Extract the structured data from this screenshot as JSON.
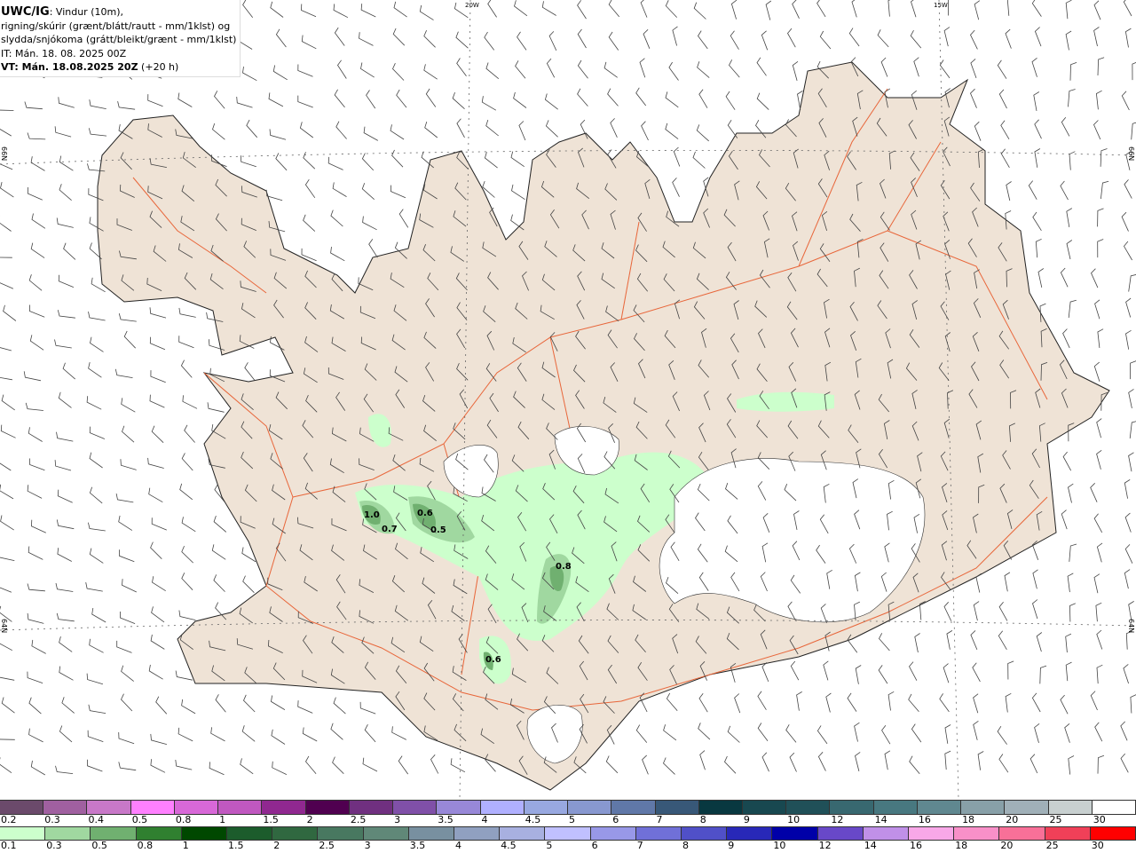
{
  "header": {
    "product": "UWC/IG",
    "line1": ": Vindur (10m),",
    "line2": "rigning/skúrir (grænt/blátt/rautt - mm/1klst) og",
    "line3": "slydda/snjókoma (grátt/bleikt/grænt - mm/1klst)",
    "it": "IT: Mán. 18. 08. 2025 00Z",
    "vt_bold": "VT: Mán. 18.08.2025 20Z",
    "vt_lead": " (+20 h)"
  },
  "map": {
    "grid_labels": {
      "lon_20w": "20W",
      "lon_15w": "15W",
      "lat_66n": "66N",
      "lat_64n": "64N"
    },
    "precip_labels": [
      "1.0",
      "0.7",
      "0.6",
      "0.5",
      "0.8",
      "0.6"
    ],
    "colors": {
      "land": "#efe3d6",
      "sea": "#ffffff",
      "glacier": "#ffffff",
      "roads": "#e8663a",
      "rain_light": "#ccffcc",
      "rain_mid": "#a0d8a0",
      "rain_dark": "#70b070"
    }
  },
  "colorbar_snow": {
    "labels": [
      "0.2",
      "0.3",
      "0.4",
      "0.5",
      "0.8",
      "1",
      "1.5",
      "2",
      "2.5",
      "3",
      "3.5",
      "4",
      "4.5",
      "5",
      "6",
      "7",
      "8",
      "9",
      "10",
      "12",
      "14",
      "16",
      "18",
      "20",
      "25",
      "30"
    ],
    "colors": [
      "#6b4a6b",
      "#a060a0",
      "#c878c8",
      "#ff80ff",
      "#d868d8",
      "#c058c0",
      "#902890",
      "#500050",
      "#703080",
      "#8050a8",
      "#9888d8",
      "#b0b0ff",
      "#98a8e0",
      "#8898d0",
      "#6078a8",
      "#385878",
      "#083840",
      "#184850",
      "#205058",
      "#386870",
      "#487880",
      "#608890",
      "#88a0a8",
      "#a0b0b8",
      "#c8d0d0",
      "#ffffff"
    ]
  },
  "colorbar_rain": {
    "labels": [
      "0.1",
      "0.3",
      "0.5",
      "0.8",
      "1",
      "1.5",
      "2",
      "2.5",
      "3",
      "3.5",
      "4",
      "4.5",
      "5",
      "6",
      "7",
      "8",
      "9",
      "10",
      "12",
      "14",
      "16",
      "18",
      "20",
      "25",
      "30"
    ],
    "colors": [
      "#ccffcc",
      "#a0d8a0",
      "#70b070",
      "#308030",
      "#004800",
      "#1c5c2c",
      "#306840",
      "#487860",
      "#608878",
      "#7890a0",
      "#90a0c0",
      "#a8b0e0",
      "#c0c0ff",
      "#9898e8",
      "#7070d8",
      "#5050c8",
      "#2828b8",
      "#0000a8",
      "#6848c8",
      "#c090e8",
      "#f8a8e8",
      "#f890c8",
      "#f87098",
      "#f04058",
      "#ff0000"
    ]
  }
}
